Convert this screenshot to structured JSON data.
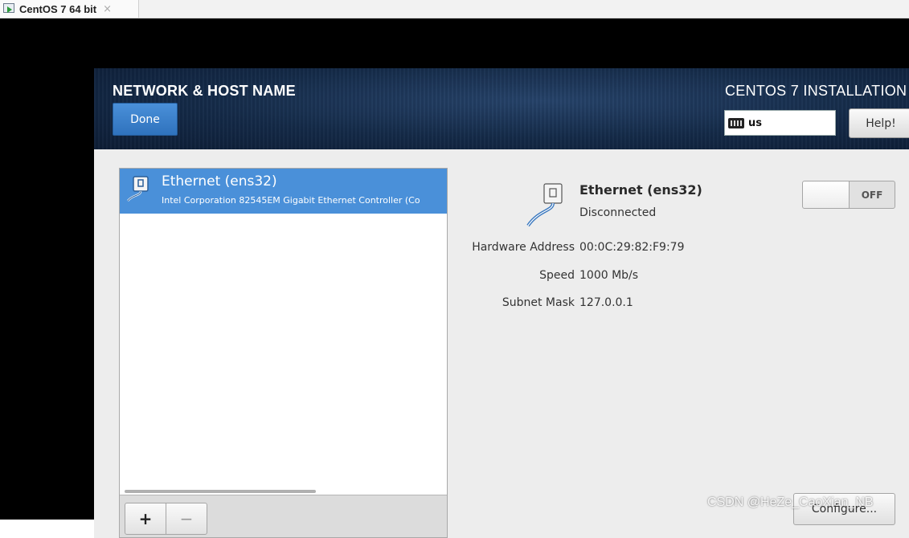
{
  "vm_tab": {
    "label": "CentOS 7 64 bit",
    "close": "×"
  },
  "header": {
    "spoke_title": "NETWORK & HOST NAME",
    "done_label": "Done",
    "product_title": "CENTOS 7 INSTALLATION",
    "keyboard_layout": "us",
    "help_label": "Help!"
  },
  "device_list": {
    "items": [
      {
        "name": "Ethernet (ens32)",
        "description": "Intel Corporation 82545EM Gigabit Ethernet Controller (Co"
      }
    ],
    "add_label": "+",
    "remove_label": "−"
  },
  "details": {
    "name": "Ethernet (ens32)",
    "status": "Disconnected",
    "hardware_address_label": "Hardware Address",
    "hardware_address": "00:0C:29:82:F9:79",
    "speed_label": "Speed",
    "speed": "1000 Mb/s",
    "subnet_label": "Subnet Mask",
    "subnet": "127.0.0.1",
    "toggle_label": "OFF",
    "configure_label": "Configure..."
  },
  "watermark": "CSDN @HeZe_CaoXian_NB",
  "colors": {
    "accent": "#4a90d9",
    "header_bg": "#142a48",
    "console_bg": "#000000"
  }
}
